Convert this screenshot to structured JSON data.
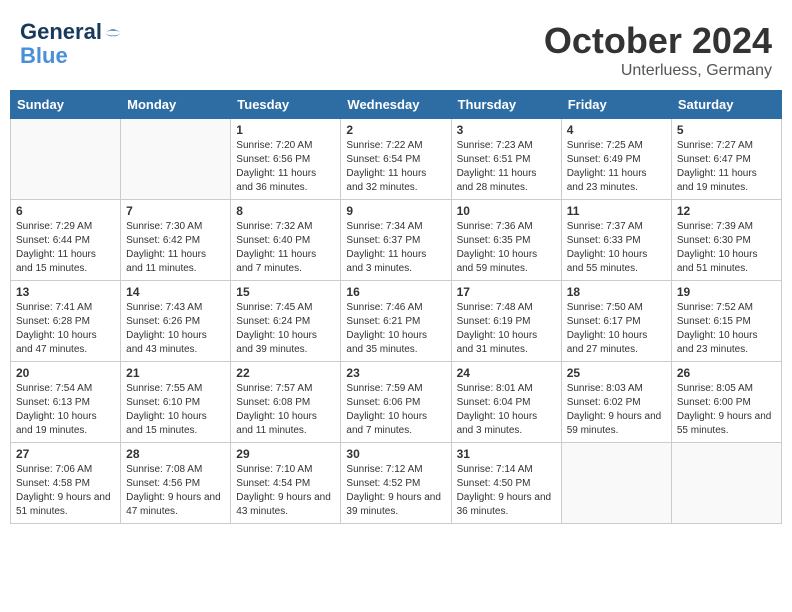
{
  "header": {
    "logo_line1": "General",
    "logo_line2": "Blue",
    "month": "October 2024",
    "location": "Unterluess, Germany"
  },
  "weekdays": [
    "Sunday",
    "Monday",
    "Tuesday",
    "Wednesday",
    "Thursday",
    "Friday",
    "Saturday"
  ],
  "weeks": [
    [
      {
        "day": "",
        "info": ""
      },
      {
        "day": "",
        "info": ""
      },
      {
        "day": "1",
        "info": "Sunrise: 7:20 AM\nSunset: 6:56 PM\nDaylight: 11 hours and 36 minutes."
      },
      {
        "day": "2",
        "info": "Sunrise: 7:22 AM\nSunset: 6:54 PM\nDaylight: 11 hours and 32 minutes."
      },
      {
        "day": "3",
        "info": "Sunrise: 7:23 AM\nSunset: 6:51 PM\nDaylight: 11 hours and 28 minutes."
      },
      {
        "day": "4",
        "info": "Sunrise: 7:25 AM\nSunset: 6:49 PM\nDaylight: 11 hours and 23 minutes."
      },
      {
        "day": "5",
        "info": "Sunrise: 7:27 AM\nSunset: 6:47 PM\nDaylight: 11 hours and 19 minutes."
      }
    ],
    [
      {
        "day": "6",
        "info": "Sunrise: 7:29 AM\nSunset: 6:44 PM\nDaylight: 11 hours and 15 minutes."
      },
      {
        "day": "7",
        "info": "Sunrise: 7:30 AM\nSunset: 6:42 PM\nDaylight: 11 hours and 11 minutes."
      },
      {
        "day": "8",
        "info": "Sunrise: 7:32 AM\nSunset: 6:40 PM\nDaylight: 11 hours and 7 minutes."
      },
      {
        "day": "9",
        "info": "Sunrise: 7:34 AM\nSunset: 6:37 PM\nDaylight: 11 hours and 3 minutes."
      },
      {
        "day": "10",
        "info": "Sunrise: 7:36 AM\nSunset: 6:35 PM\nDaylight: 10 hours and 59 minutes."
      },
      {
        "day": "11",
        "info": "Sunrise: 7:37 AM\nSunset: 6:33 PM\nDaylight: 10 hours and 55 minutes."
      },
      {
        "day": "12",
        "info": "Sunrise: 7:39 AM\nSunset: 6:30 PM\nDaylight: 10 hours and 51 minutes."
      }
    ],
    [
      {
        "day": "13",
        "info": "Sunrise: 7:41 AM\nSunset: 6:28 PM\nDaylight: 10 hours and 47 minutes."
      },
      {
        "day": "14",
        "info": "Sunrise: 7:43 AM\nSunset: 6:26 PM\nDaylight: 10 hours and 43 minutes."
      },
      {
        "day": "15",
        "info": "Sunrise: 7:45 AM\nSunset: 6:24 PM\nDaylight: 10 hours and 39 minutes."
      },
      {
        "day": "16",
        "info": "Sunrise: 7:46 AM\nSunset: 6:21 PM\nDaylight: 10 hours and 35 minutes."
      },
      {
        "day": "17",
        "info": "Sunrise: 7:48 AM\nSunset: 6:19 PM\nDaylight: 10 hours and 31 minutes."
      },
      {
        "day": "18",
        "info": "Sunrise: 7:50 AM\nSunset: 6:17 PM\nDaylight: 10 hours and 27 minutes."
      },
      {
        "day": "19",
        "info": "Sunrise: 7:52 AM\nSunset: 6:15 PM\nDaylight: 10 hours and 23 minutes."
      }
    ],
    [
      {
        "day": "20",
        "info": "Sunrise: 7:54 AM\nSunset: 6:13 PM\nDaylight: 10 hours and 19 minutes."
      },
      {
        "day": "21",
        "info": "Sunrise: 7:55 AM\nSunset: 6:10 PM\nDaylight: 10 hours and 15 minutes."
      },
      {
        "day": "22",
        "info": "Sunrise: 7:57 AM\nSunset: 6:08 PM\nDaylight: 10 hours and 11 minutes."
      },
      {
        "day": "23",
        "info": "Sunrise: 7:59 AM\nSunset: 6:06 PM\nDaylight: 10 hours and 7 minutes."
      },
      {
        "day": "24",
        "info": "Sunrise: 8:01 AM\nSunset: 6:04 PM\nDaylight: 10 hours and 3 minutes."
      },
      {
        "day": "25",
        "info": "Sunrise: 8:03 AM\nSunset: 6:02 PM\nDaylight: 9 hours and 59 minutes."
      },
      {
        "day": "26",
        "info": "Sunrise: 8:05 AM\nSunset: 6:00 PM\nDaylight: 9 hours and 55 minutes."
      }
    ],
    [
      {
        "day": "27",
        "info": "Sunrise: 7:06 AM\nSunset: 4:58 PM\nDaylight: 9 hours and 51 minutes."
      },
      {
        "day": "28",
        "info": "Sunrise: 7:08 AM\nSunset: 4:56 PM\nDaylight: 9 hours and 47 minutes."
      },
      {
        "day": "29",
        "info": "Sunrise: 7:10 AM\nSunset: 4:54 PM\nDaylight: 9 hours and 43 minutes."
      },
      {
        "day": "30",
        "info": "Sunrise: 7:12 AM\nSunset: 4:52 PM\nDaylight: 9 hours and 39 minutes."
      },
      {
        "day": "31",
        "info": "Sunrise: 7:14 AM\nSunset: 4:50 PM\nDaylight: 9 hours and 36 minutes."
      },
      {
        "day": "",
        "info": ""
      },
      {
        "day": "",
        "info": ""
      }
    ]
  ]
}
